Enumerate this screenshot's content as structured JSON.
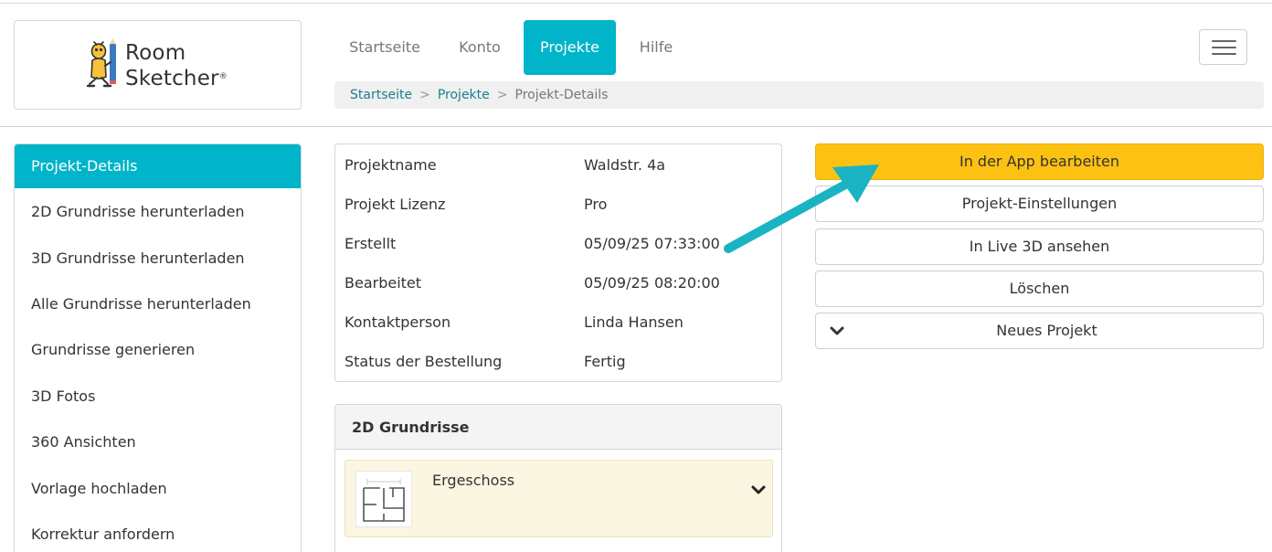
{
  "logo": {
    "line1": "Room",
    "line2": "Sketcher",
    "reg": "®"
  },
  "nav": {
    "tabs": [
      {
        "label": "Startseite"
      },
      {
        "label": "Konto"
      },
      {
        "label": "Projekte",
        "active": true
      },
      {
        "label": "Hilfe"
      }
    ]
  },
  "breadcrumb": {
    "items": [
      "Startseite",
      "Projekte",
      "Projekt-Details"
    ],
    "separator": ">"
  },
  "sidebar": {
    "items": [
      {
        "label": "Projekt-Details",
        "active": true
      },
      {
        "label": "2D Grundrisse herunterladen"
      },
      {
        "label": "3D Grundrisse herunterladen"
      },
      {
        "label": "Alle Grundrisse herunterladen"
      },
      {
        "label": "Grundrisse generieren"
      },
      {
        "label": "3D Fotos"
      },
      {
        "label": "360 Ansichten"
      },
      {
        "label": "Vorlage hochladen"
      },
      {
        "label": "Korrektur anfordern"
      }
    ]
  },
  "details": {
    "rows": [
      {
        "label": "Projektname",
        "value": "Waldstr. 4a"
      },
      {
        "label": "Projekt Lizenz",
        "value": "Pro"
      },
      {
        "label": "Erstellt",
        "value": "05/09/25 07:33:00"
      },
      {
        "label": "Bearbeitet",
        "value": "05/09/25 08:20:00"
      },
      {
        "label": "Kontaktperson",
        "value": "Linda Hansen"
      },
      {
        "label": "Status der Bestellung",
        "value": "Fertig"
      }
    ]
  },
  "floorplans": {
    "title": "2D Grundrisse",
    "items": [
      {
        "name": "Ergeschoss"
      }
    ]
  },
  "actions": {
    "edit_in_app": "In der App bearbeiten",
    "project_settings": "Projekt-Einstellungen",
    "live_3d": "In Live 3D ansehen",
    "delete": "Löschen",
    "new_project": "Neues Projekt"
  },
  "colors": {
    "accent": "#00b4c9",
    "primary_button": "#fdc211",
    "link": "#1a7f8e",
    "floor_card_bg": "#fbf6e1",
    "annotation_arrow": "#1ab3c4"
  },
  "icons": {
    "menu": "hamburger-icon",
    "floor_expand": "chevron-down-icon",
    "new_project_dropdown": "chevron-down-icon"
  }
}
